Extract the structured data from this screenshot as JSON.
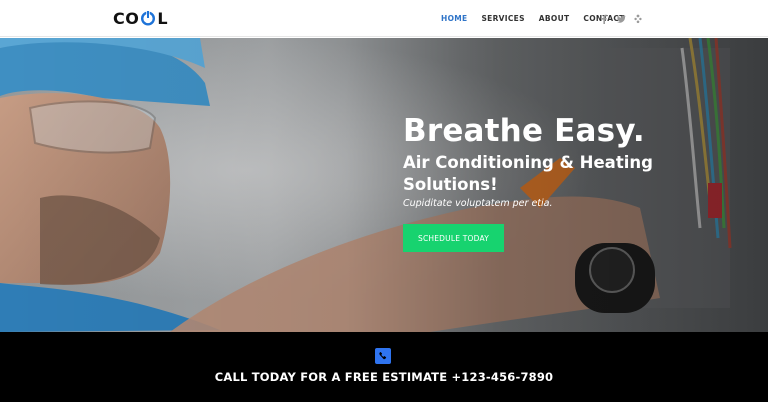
{
  "header": {
    "logo": {
      "left": "CO",
      "right": "L"
    },
    "nav": [
      {
        "label": "HOME"
      },
      {
        "label": "SERVICES"
      },
      {
        "label": "ABOUT"
      },
      {
        "label": "CONTACT"
      }
    ],
    "social": [
      "facebook-icon",
      "twitter-icon",
      "yelp-icon"
    ]
  },
  "hero": {
    "title": "Breathe Easy.",
    "subtitle_line1": "Air Conditioning & Heating",
    "subtitle_line2": "Solutions!",
    "tagline": "Cupiditate voluptatem per etia.",
    "cta_label": "SCHEDULE TODAY"
  },
  "callbar": {
    "text": "CALL TODAY FOR A FREE ESTIMATE +123-456-7890",
    "icon": "phone-icon"
  },
  "colors": {
    "accent_blue": "#2f74c8",
    "cta_green": "#17d36f",
    "callbar_bg": "#000000"
  }
}
